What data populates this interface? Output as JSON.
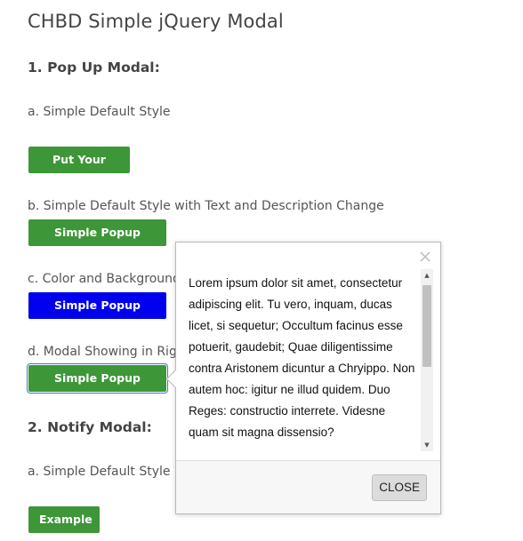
{
  "page": {
    "title": "CHBD Simple jQuery Modal"
  },
  "sections": {
    "popup": {
      "heading": "1. Pop Up Modal:",
      "a_label": "a. Simple Default Style",
      "a_button": "Put Your Text",
      "b_label": "b. Simple Default Style with Text and Description Change",
      "b_button": "Simple Popup Modal",
      "c_label": "c. Color and Background",
      "c_button": "Simple Popup Modal",
      "d_label": "d. Modal Showing in Righ",
      "d_button": "Simple Popup Modal"
    },
    "notify": {
      "heading": "2. Notify Modal:",
      "a_label": "a. Simple Default Style",
      "a_button": "Example"
    }
  },
  "modal": {
    "body_text": "Lorem ipsum dolor sit amet, consectetur adipiscing elit. Tu vero, inquam, ducas licet, si sequetur; Occultum facinus esse potuerit, gaudebit; Quae diligentissime contra Aristonem dicuntur a Chryippo. Non autem hoc: igitur ne illud quidem. Duo Reges: constructio interrete. Videsne quam sit magna dissensio?",
    "close_label": "CLOSE",
    "close_icon": "close-icon"
  },
  "colors": {
    "green_button": "#3d9637",
    "blue_button": "#0000ee",
    "modal_footer": "#f7f7f7"
  }
}
